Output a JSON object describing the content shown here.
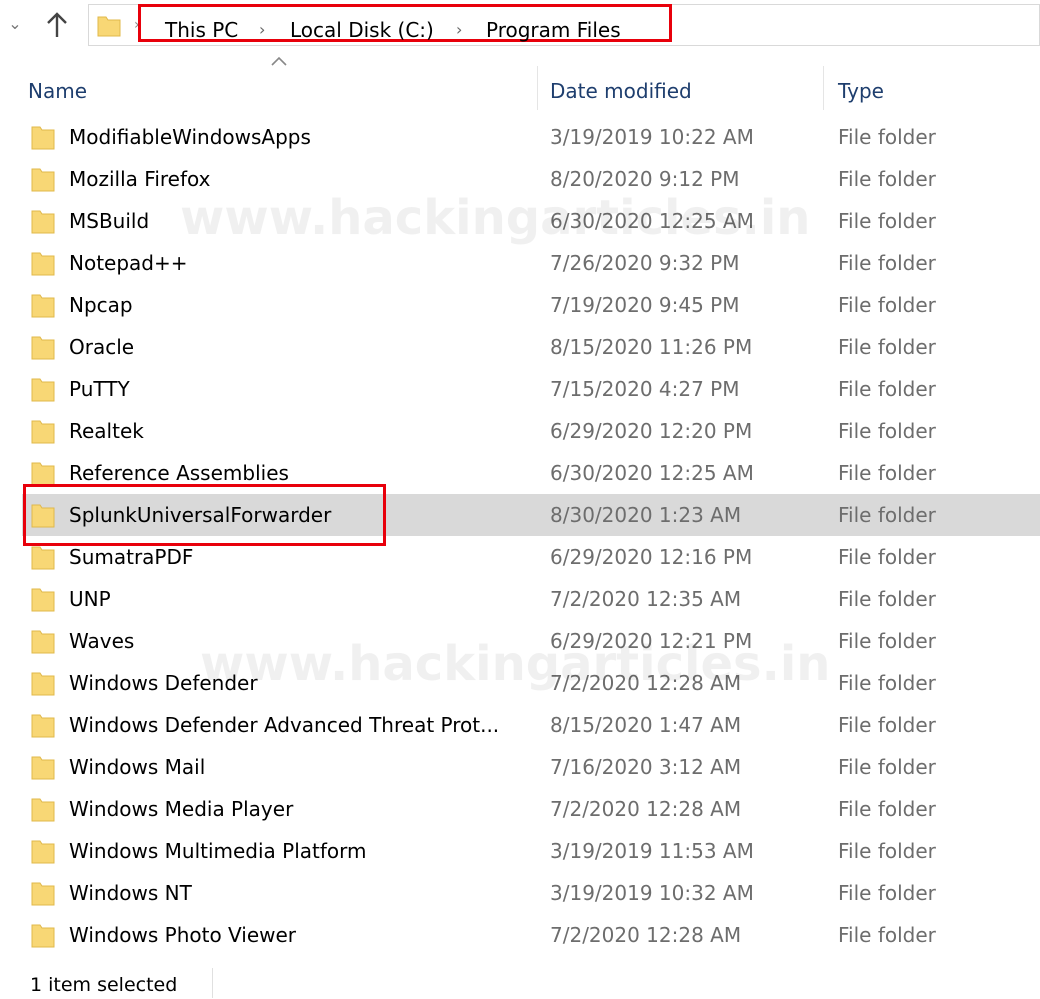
{
  "address_bar": {
    "crumbs": [
      "This PC",
      "Local Disk (C:)",
      "Program Files"
    ]
  },
  "columns": {
    "name": "Name",
    "date": "Date modified",
    "type": "Type"
  },
  "rows": [
    {
      "name": "ModifiableWindowsApps",
      "date": "3/19/2019 10:22 AM",
      "type": "File folder"
    },
    {
      "name": "Mozilla Firefox",
      "date": "8/20/2020 9:12 PM",
      "type": "File folder"
    },
    {
      "name": "MSBuild",
      "date": "6/30/2020 12:25 AM",
      "type": "File folder"
    },
    {
      "name": "Notepad++",
      "date": "7/26/2020 9:32 PM",
      "type": "File folder"
    },
    {
      "name": "Npcap",
      "date": "7/19/2020 9:45 PM",
      "type": "File folder"
    },
    {
      "name": "Oracle",
      "date": "8/15/2020 11:26 PM",
      "type": "File folder"
    },
    {
      "name": "PuTTY",
      "date": "7/15/2020 4:27 PM",
      "type": "File folder"
    },
    {
      "name": "Realtek",
      "date": "6/29/2020 12:20 PM",
      "type": "File folder"
    },
    {
      "name": "Reference Assemblies",
      "date": "6/30/2020 12:25 AM",
      "type": "File folder"
    },
    {
      "name": "SplunkUniversalForwarder",
      "date": "8/30/2020 1:23 AM",
      "type": "File folder",
      "selected": true
    },
    {
      "name": "SumatraPDF",
      "date": "6/29/2020 12:16 PM",
      "type": "File folder"
    },
    {
      "name": "UNP",
      "date": "7/2/2020 12:35 AM",
      "type": "File folder"
    },
    {
      "name": "Waves",
      "date": "6/29/2020 12:21 PM",
      "type": "File folder"
    },
    {
      "name": "Windows Defender",
      "date": "7/2/2020 12:28 AM",
      "type": "File folder"
    },
    {
      "name": "Windows Defender Advanced Threat Prot...",
      "date": "8/15/2020 1:47 AM",
      "type": "File folder"
    },
    {
      "name": "Windows Mail",
      "date": "7/16/2020 3:12 AM",
      "type": "File folder"
    },
    {
      "name": "Windows Media Player",
      "date": "7/2/2020 12:28 AM",
      "type": "File folder"
    },
    {
      "name": "Windows Multimedia Platform",
      "date": "3/19/2019 11:53 AM",
      "type": "File folder"
    },
    {
      "name": "Windows NT",
      "date": "3/19/2019 10:32 AM",
      "type": "File folder"
    },
    {
      "name": "Windows Photo Viewer",
      "date": "7/2/2020 12:28 AM",
      "type": "File folder"
    }
  ],
  "watermark": "www.hackingarticles.in",
  "status": "1 item selected",
  "colors": {
    "highlight": "#e8000b",
    "selection": "#d9d9d9",
    "folder": "#f8d775"
  }
}
